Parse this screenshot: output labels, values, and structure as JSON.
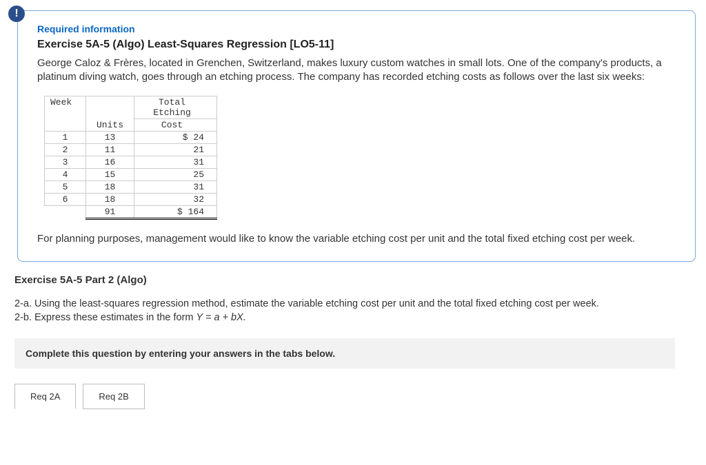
{
  "alert_glyph": "!",
  "box": {
    "req_title": "Required information",
    "exercise_title": "Exercise 5A-5 (Algo) Least-Squares Regression [LO5-11]",
    "description": "George Caloz & Frères, located in Grenchen, Switzerland, makes luxury custom watches in small lots. One of the company's products, a platinum diving watch, goes through an etching process. The company has recorded etching costs as follows over the last six weeks:",
    "table": {
      "headers": {
        "week": "Week",
        "units": "Units",
        "cost_line1": "Total Etching",
        "cost_line2": "Cost"
      },
      "rows": [
        {
          "week": "1",
          "units": "13",
          "cost": "$ 24"
        },
        {
          "week": "2",
          "units": "11",
          "cost": "21"
        },
        {
          "week": "3",
          "units": "16",
          "cost": "31"
        },
        {
          "week": "4",
          "units": "15",
          "cost": "25"
        },
        {
          "week": "5",
          "units": "18",
          "cost": "31"
        },
        {
          "week": "6",
          "units": "18",
          "cost": "32"
        }
      ],
      "totals": {
        "units": "91",
        "cost": "$ 164"
      }
    },
    "followup": "For planning purposes, management would like to know the variable etching cost per unit and the total fixed etching cost per week."
  },
  "part2": {
    "title": "Exercise 5A-5 Part 2 (Algo)",
    "q2a": "2-a. Using the least-squares regression method, estimate the variable etching cost per unit and the total fixed etching cost per week.",
    "q2b_prefix": "2-b. Express these estimates in the form ",
    "q2b_formula": "Y = a + bX.",
    "instruction": "Complete this question by entering your answers in the tabs below.",
    "tabs": {
      "a": "Req 2A",
      "b": "Req 2B"
    }
  },
  "chart_data": {
    "type": "table",
    "columns": [
      "Week",
      "Units",
      "Total Etching Cost"
    ],
    "rows": [
      [
        1,
        13,
        24
      ],
      [
        2,
        11,
        21
      ],
      [
        3,
        16,
        31
      ],
      [
        4,
        15,
        25
      ],
      [
        5,
        18,
        31
      ],
      [
        6,
        18,
        32
      ]
    ],
    "totals": {
      "Units": 91,
      "Total Etching Cost": 164
    }
  }
}
